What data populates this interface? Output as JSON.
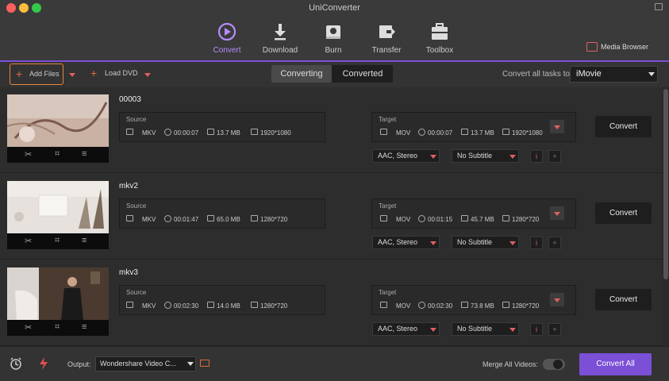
{
  "window": {
    "title": "UniConverter"
  },
  "toolbar": {
    "tabs": [
      {
        "label": "Convert",
        "icon": "convert-icon",
        "active": true
      },
      {
        "label": "Download",
        "icon": "download-icon",
        "active": false
      },
      {
        "label": "Burn",
        "icon": "burn-icon",
        "active": false
      },
      {
        "label": "Transfer",
        "icon": "transfer-icon",
        "active": false
      },
      {
        "label": "Toolbox",
        "icon": "toolbox-icon",
        "active": false
      }
    ],
    "media_browser": "Media Browser"
  },
  "actionbar": {
    "add_files": "Add Files",
    "load_dvd": "Load DVD",
    "segments": [
      "Converting",
      "Converted"
    ],
    "convert_all_label": "Convert all tasks to:",
    "convert_all_value": "iMovie"
  },
  "files": [
    {
      "name": "00003",
      "source": {
        "label": "Source",
        "format": "MKV",
        "duration": "00:00:07",
        "size": "13.7 MB",
        "resolution": "1920*1080"
      },
      "target": {
        "label": "Target",
        "format": "MOV",
        "duration": "00:00:07",
        "size": "13.7 MB",
        "resolution": "1920*1080"
      },
      "audio": "AAC, Stereo",
      "subtitle": "No Subtitle",
      "convert": "Convert"
    },
    {
      "name": "mkv2",
      "source": {
        "label": "Source",
        "format": "MKV",
        "duration": "00:01:47",
        "size": "65.0 MB",
        "resolution": "1280*720"
      },
      "target": {
        "label": "Target",
        "format": "MOV",
        "duration": "00:01:15",
        "size": "45.7 MB",
        "resolution": "1280*720"
      },
      "audio": "AAC, Stereo",
      "subtitle": "No Subtitle",
      "convert": "Convert"
    },
    {
      "name": "mkv3",
      "source": {
        "label": "Source",
        "format": "MKV",
        "duration": "00:02:30",
        "size": "14.0 MB",
        "resolution": "1280*720"
      },
      "target": {
        "label": "Target",
        "format": "MOV",
        "duration": "00:02:30",
        "size": "73.8 MB",
        "resolution": "1280*720"
      },
      "audio": "AAC, Stereo",
      "subtitle": "No Subtitle",
      "convert": "Convert"
    }
  ],
  "bottombar": {
    "output_label": "Output:",
    "output_value": "Wondershare Video C...",
    "merge_label": "Merge All Videos:",
    "convert_all": "Convert All"
  },
  "colors": {
    "accent": "#7b4fd6",
    "highlight": "#e6843a",
    "icon_red": "#e06060"
  }
}
